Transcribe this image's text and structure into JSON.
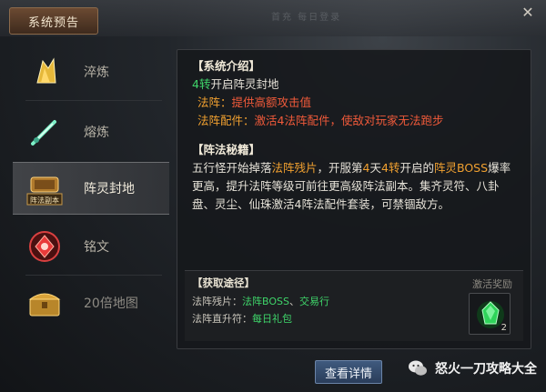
{
  "window": {
    "title": "系统预告",
    "close_label": "✕"
  },
  "sidebar": {
    "items": [
      {
        "label": "淬炼",
        "icon": "gold-crystal-icon"
      },
      {
        "label": "熔炼",
        "icon": "jade-sword-icon"
      },
      {
        "label": "阵灵封地",
        "icon": "formation-chest-icon",
        "icon_text": "阵法副本",
        "active": true
      },
      {
        "label": "铭文",
        "icon": "red-rune-icon"
      },
      {
        "label": "20倍地图",
        "icon": "treasure-chest-icon"
      }
    ]
  },
  "intro": {
    "heading": "【系统介绍】",
    "line1_num": "4转",
    "line1_rest": "开启阵灵封地",
    "line2_label": "法阵：",
    "line2_value": "提供高额攻击值",
    "line3_label": "法阵配件：",
    "line3_value": "激活4法阵配件，使敌对玩家无法跑步"
  },
  "secret": {
    "heading": "【阵法秘籍】",
    "p1": "五行怪开始掉落",
    "p2": "法阵残片",
    "p3": "，开服第",
    "p4": "4",
    "p5": "天",
    "p6": "4转",
    "p7": "开启的",
    "p8": "阵灵BOSS",
    "p9": "爆率更高，提升法阵等级可前往更高级阵法副本。集齐灵符、八卦盘、灵尘、仙珠激活4阵法配件套装，可禁锢敌方。"
  },
  "reward": {
    "heading": "【获取途径】",
    "row1_label": "法阵残片：",
    "row1_link1": "法阵BOSS",
    "row1_sep": "、",
    "row1_link2": "交易行",
    "row2_label": "法阵直升符：",
    "row2_link1": "每日礼包",
    "activate_title": "激活奖励",
    "item_count": "2",
    "item_icon": "green-gem-icon"
  },
  "detail_button": "查看详情",
  "background": {
    "faint_text": "首充   每日登录"
  },
  "watermark": {
    "text": "怒火一刀攻略大全",
    "icon": "wechat-icon"
  }
}
